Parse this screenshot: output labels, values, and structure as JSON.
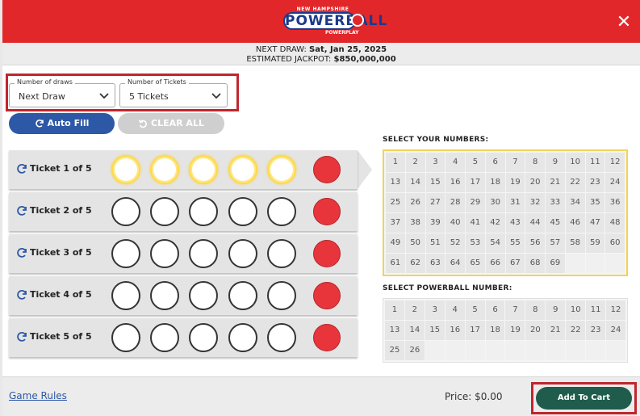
{
  "header": {
    "logo_top": "NEW HAMPSHIRE",
    "logo_main": "POWERBALL",
    "logo_ball": "ball",
    "logo_sub": "POWERPLAY",
    "close_icon": "close-icon",
    "accent": "#e2272a"
  },
  "draw_info": {
    "next_draw_label": "NEXT DRAW:",
    "next_draw_value": "Sat, Jan 25, 2025",
    "jackpot_label": "ESTIMATED JACKPOT:",
    "jackpot_value": "$850,000,000"
  },
  "controls": {
    "draws_label": "Number of draws",
    "draws_value": "Next Draw",
    "tickets_label": "Number of Tickets",
    "tickets_value": "5 Tickets",
    "autofill_label": "Auto Fill",
    "clearall_label": "CLEAR ALL"
  },
  "tickets": [
    {
      "label": "Ticket 1 of 5"
    },
    {
      "label": "Ticket 2 of 5"
    },
    {
      "label": "Ticket 3 of 5"
    },
    {
      "label": "Ticket 4 of 5"
    },
    {
      "label": "Ticket 5 of 5"
    }
  ],
  "number_picker": {
    "main_title": "SELECT YOUR NUMBERS:",
    "main_max": 69,
    "powerball_title": "SELECT POWERBALL NUMBER:",
    "powerball_max": 26
  },
  "footer": {
    "rules_link": "Game Rules",
    "price": "Price: $0.00",
    "cart_button": "Add To Cart",
    "cart_color": "#1f5c4c"
  }
}
